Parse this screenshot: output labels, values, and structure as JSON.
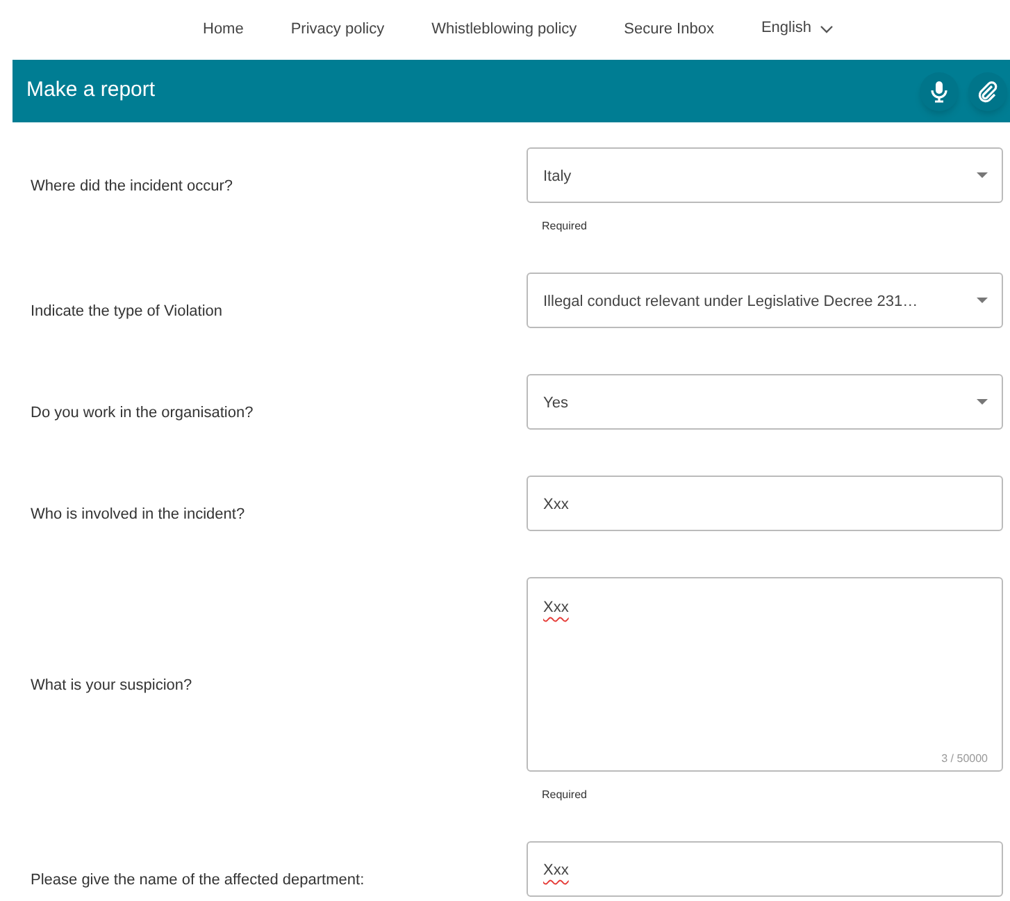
{
  "nav": {
    "links": [
      "Home",
      "Privacy policy",
      "Whistleblowing policy",
      "Secure Inbox"
    ],
    "language": "English"
  },
  "header": {
    "title": "Make a report"
  },
  "fields": [
    {
      "kind": "select",
      "label": "Where did the incident occur?",
      "value": "Italy",
      "hint": "Required",
      "misspelled": false
    },
    {
      "kind": "select",
      "label": "Indicate the type of Violation",
      "value": "Illegal conduct relevant under Legislative Decree 231…",
      "misspelled": false
    },
    {
      "kind": "select",
      "label": "Do you work in the organisation?",
      "value": "Yes",
      "misspelled": false
    },
    {
      "kind": "input",
      "label": "Who is involved in the incident?",
      "value": "Xxx",
      "misspelled": false
    },
    {
      "kind": "textarea",
      "label": "What is your suspicion?",
      "value": "Xxx",
      "counter": "3 / 50000",
      "hint": "Required",
      "misspelled": true
    },
    {
      "kind": "input",
      "label": "Please give the name of the affected department:",
      "value": "Xxx",
      "misspelled": true
    }
  ]
}
